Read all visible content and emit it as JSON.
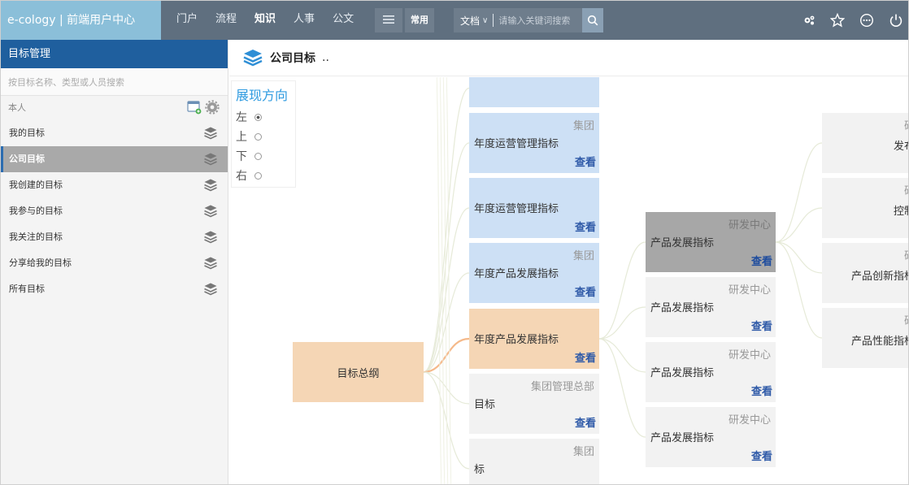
{
  "brand": "e-cology | 前端用户中心",
  "nav": [
    "门户",
    "流程",
    "知识",
    "人事",
    "公文"
  ],
  "nav_active": "知识",
  "common_label": "常用",
  "search": {
    "category": "文档",
    "placeholder": "请输入关键词搜索"
  },
  "sidebar": {
    "title": "目标管理",
    "search_placeholder": "按目标名称、类型或人员搜索",
    "section": "本人",
    "items": [
      "我的目标",
      "公司目标",
      "我创建的目标",
      "我参与的目标",
      "我关注的目标",
      "分享给我的目标",
      "所有目标"
    ],
    "active": "公司目标"
  },
  "main": {
    "title": "公司目标",
    "ellipsis": ".."
  },
  "direction": {
    "title": "展现方向",
    "options": [
      "左",
      "上",
      "下",
      "右"
    ],
    "selected": "左"
  },
  "view_label": "查看",
  "tree": {
    "root": "目标总纲",
    "level1": [
      {
        "org": "",
        "name": ""
      },
      {
        "org": "集团",
        "name": "年度运营管理指标"
      },
      {
        "org": "",
        "name": "年度运营管理指标"
      },
      {
        "org": "集团",
        "name": "年度产品发展指标"
      },
      {
        "org": "",
        "name": "年度产品发展指标"
      },
      {
        "org": "集团管理总部",
        "name": "目标"
      },
      {
        "org": "集团",
        "name": "标"
      }
    ],
    "level2": [
      {
        "org": "研发中心",
        "name": "产品发展指标"
      },
      {
        "org": "研发中心",
        "name": "产品发展指标"
      },
      {
        "org": "研发中心",
        "name": "产品发展指标"
      },
      {
        "org": "研发中心",
        "name": "产品发展指标"
      }
    ],
    "level3": [
      {
        "org": "研",
        "name": "发布"
      },
      {
        "org": "研",
        "name": "控制"
      },
      {
        "org": "研",
        "name": "产品创新指标"
      },
      {
        "org": "研",
        "name": "产品性能指标"
      }
    ]
  },
  "colors": {
    "topbar": "#5f6f7f",
    "brand": "#8bbfd9",
    "sidebar_head": "#1f5f9e",
    "accent": "#2f9be0",
    "node_blue": "#cde0f5",
    "node_orange": "#f5d6b5",
    "node_dark": "#a7a7a7",
    "link": "#2f5aa8"
  }
}
